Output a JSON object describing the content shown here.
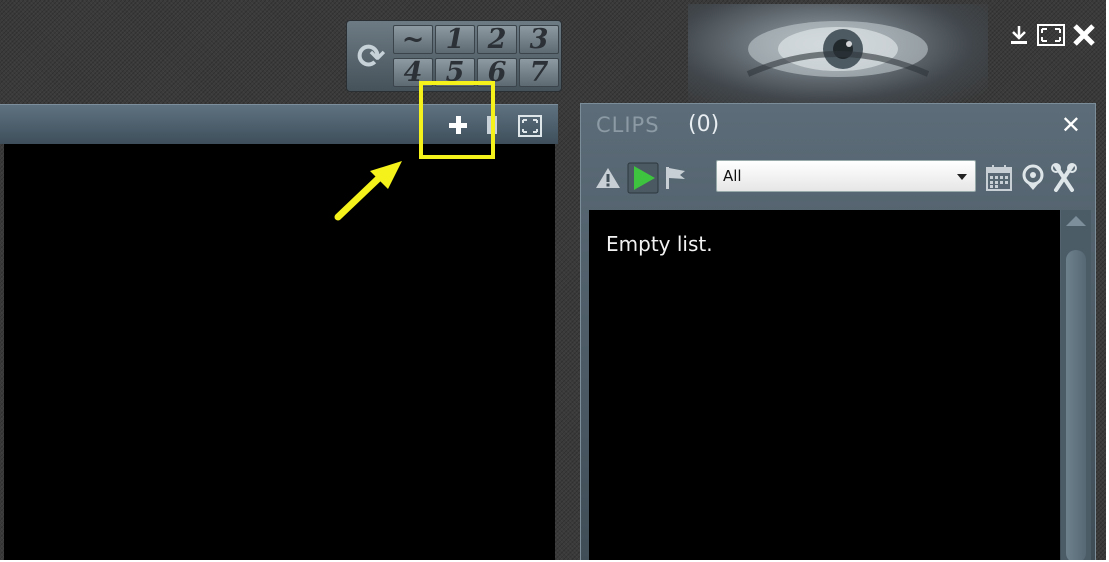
{
  "presets": {
    "row1": [
      "~",
      "1",
      "2",
      "3"
    ],
    "row2": [
      "4",
      "5",
      "6",
      "7"
    ]
  },
  "clips": {
    "title": "CLIPS",
    "count": "(0)",
    "filter": {
      "selected": "All"
    },
    "empty_text": "Empty list."
  },
  "colors": {
    "highlight": "#f4f21a",
    "play_green": "#3ec43e",
    "panel_header": "#5f7280"
  }
}
